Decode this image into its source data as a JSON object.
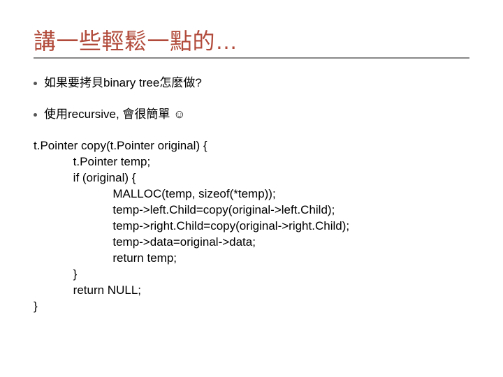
{
  "title": "講一些輕鬆一點的…",
  "bullets": [
    "如果要拷貝binary tree怎麼做?",
    "使用recursive, 會很簡單 ☺"
  ],
  "code": "t.Pointer copy(t.Pointer original) {\n            t.Pointer temp;\n            if (original) {\n                        MALLOC(temp, sizeof(*temp));\n                        temp->left.Child=copy(original->left.Child);\n                        temp->right.Child=copy(original->right.Child);\n                        temp->data=original->data;\n                        return temp;\n            }\n            return NULL;\n}"
}
